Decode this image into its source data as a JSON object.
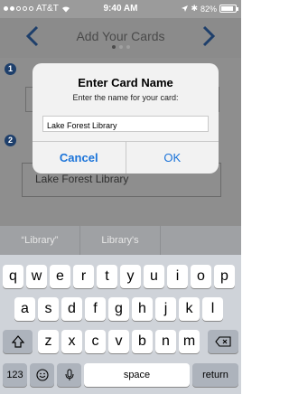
{
  "status_bar": {
    "carrier": "AT&T",
    "time": "9:40 AM",
    "battery": "82%",
    "icons": [
      "signal-dots",
      "wifi",
      "location",
      "bluetooth",
      "battery"
    ]
  },
  "nav": {
    "title": "Add Your Cards",
    "back_icon": "chevron-left",
    "forward_icon": "chevron-right",
    "page_count": 3,
    "current_page": 1
  },
  "background": {
    "step1": "1",
    "step2": "2",
    "card_name_display": "Lake Forest Library"
  },
  "alert": {
    "title": "Enter Card Name",
    "message": "Enter the name for your card:",
    "input_value": "Lake Forest Library",
    "cancel_label": "Cancel",
    "ok_label": "OK"
  },
  "keyboard": {
    "predictions": [
      "“Library”",
      "Library's",
      ""
    ],
    "row1": [
      "q",
      "w",
      "e",
      "r",
      "t",
      "y",
      "u",
      "i",
      "o",
      "p"
    ],
    "row2": [
      "a",
      "s",
      "d",
      "f",
      "g",
      "h",
      "j",
      "k",
      "l"
    ],
    "row3": [
      "z",
      "x",
      "c",
      "v",
      "b",
      "n",
      "m"
    ],
    "numbers_label": "123",
    "space_label": "space",
    "return_label": "return"
  },
  "colors": {
    "accent_blue": "#1a73d9",
    "nav_arrow": "#1e3f6b"
  }
}
